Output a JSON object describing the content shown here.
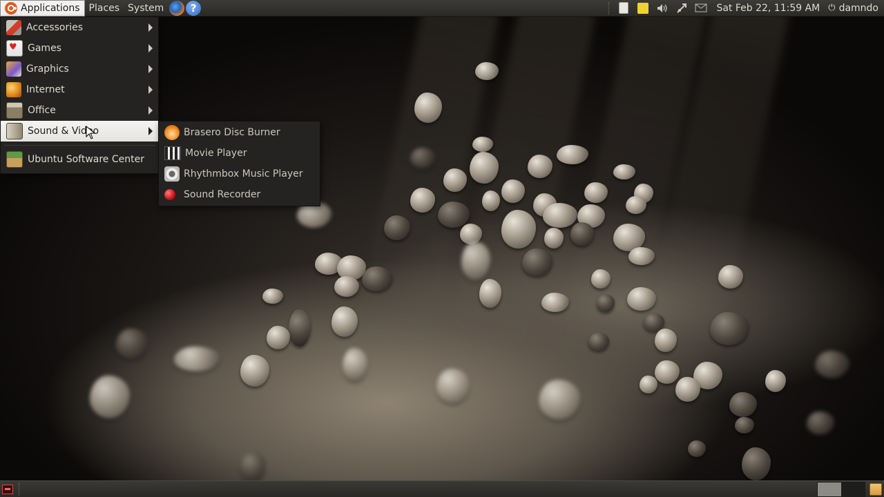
{
  "top_panel": {
    "menus": {
      "applications": "Applications",
      "places": "Places",
      "system": "System"
    },
    "launchers": [
      "firefox-icon",
      "help-icon"
    ],
    "help_glyph": "?",
    "tray_icons": [
      "notes-icon",
      "pen-icon",
      "volume-icon",
      "network-icon",
      "mail-icon"
    ],
    "clock": "Sat Feb 22, 11:59 AM",
    "user": "damndo"
  },
  "applications_menu": {
    "items": [
      {
        "label": "Accessories",
        "icon": "accessories-icon",
        "has_submenu": true
      },
      {
        "label": "Games",
        "icon": "games-icon",
        "has_submenu": true
      },
      {
        "label": "Graphics",
        "icon": "graphics-icon",
        "has_submenu": true
      },
      {
        "label": "Internet",
        "icon": "internet-icon",
        "has_submenu": true
      },
      {
        "label": "Office",
        "icon": "office-icon",
        "has_submenu": true
      },
      {
        "label": "Sound & Video",
        "icon": "sound-video-icon",
        "has_submenu": true,
        "selected": true
      }
    ],
    "footer_item": {
      "label": "Ubuntu Software Center",
      "icon": "software-center-icon"
    }
  },
  "sound_video_submenu": {
    "items": [
      {
        "label": "Brasero Disc Burner",
        "icon": "brasero-icon"
      },
      {
        "label": "Movie Player",
        "icon": "movie-player-icon"
      },
      {
        "label": "Rhythmbox Music Player",
        "icon": "rhythmbox-icon"
      },
      {
        "label": "Sound Recorder",
        "icon": "sound-recorder-icon"
      }
    ]
  },
  "bottom_panel": {
    "icons": [
      "show-desktop-icon",
      "trash-icon"
    ],
    "workspaces": 2,
    "active_workspace": 1
  },
  "colors": {
    "panel": "#3c3b37",
    "menu_bg": "#242321",
    "highlight": "#f2f1f0",
    "ubuntu_orange": "#e05a1e"
  }
}
